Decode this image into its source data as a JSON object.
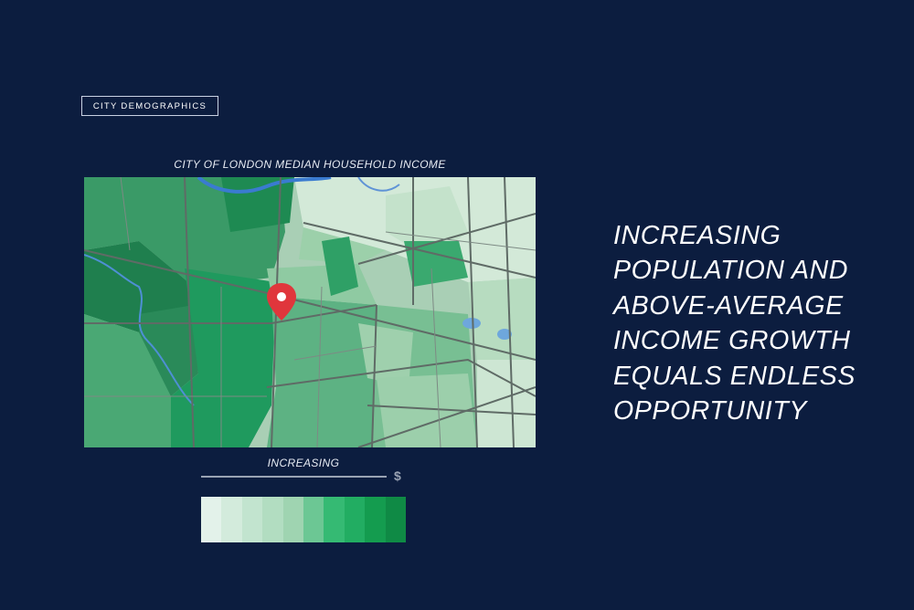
{
  "section_tag": "CITY DEMOGRAPHICS",
  "map": {
    "title": "CITY OF LONDON MEDIAN HOUSEHOLD INCOME",
    "marker_icon": "location-pin-icon",
    "colors": {
      "background_green": "#a9cfb5",
      "dark_green": "#1f8a57",
      "mid_green": "#3ea876",
      "light_green": "#7fc49a",
      "pale_green": "#c8e4d0",
      "river": "#3a7bd0",
      "roads": "#5f6b66",
      "marker": "#e0363c"
    }
  },
  "legend": {
    "label": "INCREASING",
    "currency_symbol": "$",
    "swatches": [
      "#e3f2ea",
      "#d3ebdc",
      "#c2e4cf",
      "#b2ddc1",
      "#9fd4b1",
      "#6cc794",
      "#35ba73",
      "#22ad62",
      "#149c4f",
      "#0f8a45"
    ]
  },
  "headline": {
    "lines": [
      "INCREASING",
      "POPULATION AND",
      "ABOVE-AVERAGE",
      "INCOME GROWTH",
      "EQUALS ENDLESS",
      "OPPORTUNITY"
    ]
  }
}
